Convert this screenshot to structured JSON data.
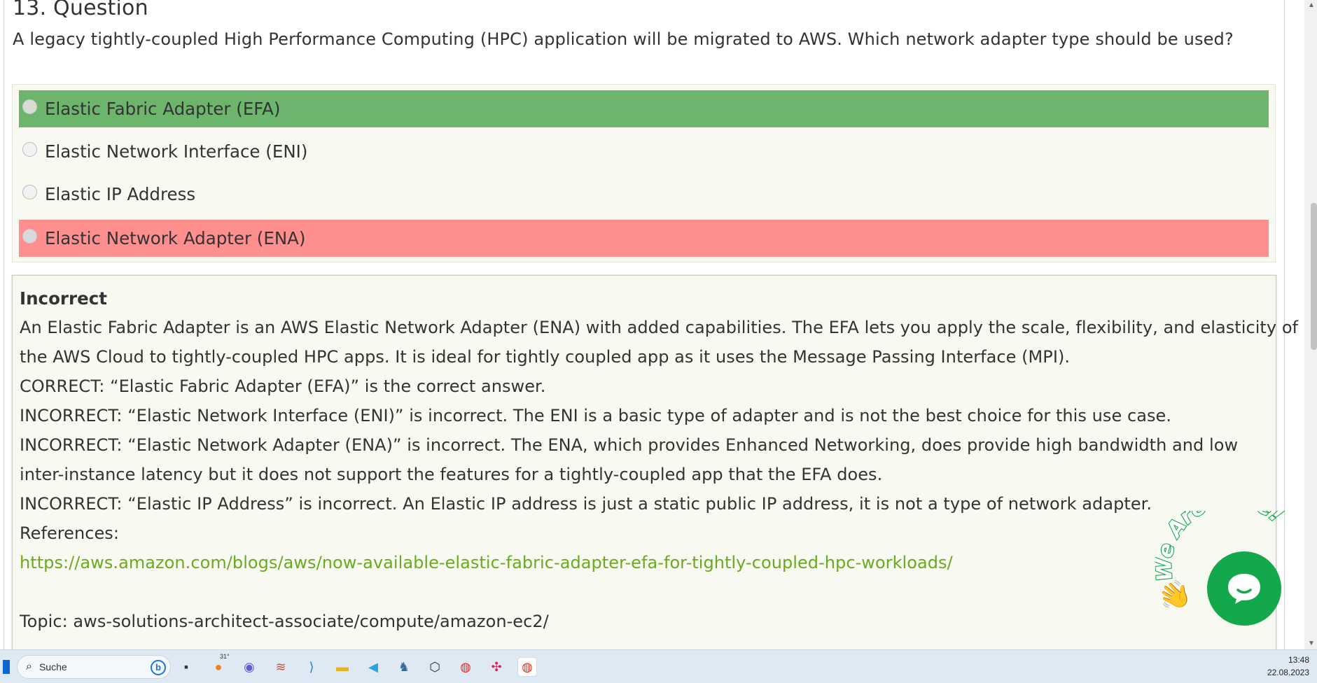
{
  "question": {
    "title": "13. Question",
    "text": "A legacy tightly-coupled High Performance Computing (HPC) application will be migrated to AWS. Which network adapter type should be used?"
  },
  "answers": [
    {
      "label": "Elastic Fabric Adapter (EFA)",
      "state": "correct"
    },
    {
      "label": "Elastic Network Interface (ENI)",
      "state": "neutral"
    },
    {
      "label": "Elastic IP Address",
      "state": "neutral"
    },
    {
      "label": "Elastic Network Adapter (ENA)",
      "state": "wrong"
    }
  ],
  "explanation": {
    "verdict": "Incorrect",
    "lines": [
      "An Elastic Fabric Adapter is an AWS Elastic Network Adapter (ENA) with added capabilities. The EFA lets you apply the scale, flexibility, and elasticity of",
      "the AWS Cloud to tightly-coupled HPC apps. It is ideal for tightly coupled app as it uses the Message Passing Interface (MPI).",
      "CORRECT: “Elastic Fabric Adapter (EFA)” is the correct answer.",
      "INCORRECT: “Elastic Network Interface (ENI)” is incorrect. The ENI is a basic type of adapter and is not the best choice for this use case.",
      "INCORRECT: “Elastic Network Adapter (ENA)” is incorrect. The ENA, which provides Enhanced Networking, does provide high bandwidth and low",
      "inter-instance latency but it does not support the features for a tightly-coupled app that the EFA does.",
      "INCORRECT: “Elastic IP Address” is incorrect. An Elastic IP address is just a static public IP address, it is not a type of network adapter.",
      "References:"
    ],
    "reference_link": "https://aws.amazon.com/blogs/aws/now-available-elastic-fabric-adapter-efa-for-tightly-coupled-hpc-workloads/",
    "topic": "Topic: aws-solutions-architect-associate/compute/amazon-ec2/"
  },
  "chat_widget": {
    "label": "We Are Here!",
    "wave": "👋",
    "brand_color": "#14a84c"
  },
  "taskbar": {
    "search_placeholder": "Suche",
    "weather_badge": "31°",
    "time": "13:48",
    "date": "22.08.2023",
    "apps": [
      "task-view-icon",
      "weather-icon",
      "chat-icon",
      "notes-icon",
      "vscode-icon",
      "file-explorer-icon",
      "telegram-icon",
      "postgres-icon",
      "virtualbox-icon",
      "chrome-icon",
      "slack-icon",
      "chrome-active-icon"
    ]
  },
  "colors": {
    "correct_bg": "#6db56d",
    "wrong_bg": "#ff8f8f",
    "link": "#6aaa1e"
  }
}
